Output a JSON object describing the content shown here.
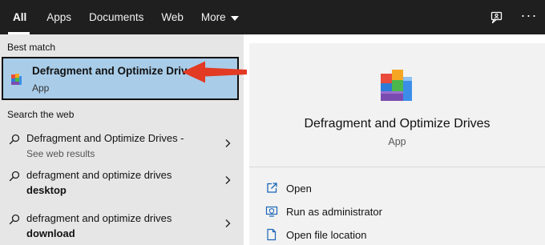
{
  "colors": {
    "topbar_bg": "#1f1f1f",
    "left_panel_bg": "#e6e6e6",
    "selected_bg": "#a9cde9",
    "right_panel_bg": "#f2f2f2",
    "action_icon": "#1a66b8",
    "arrow": "#e23a23"
  },
  "topbar": {
    "tabs": [
      {
        "label": "All",
        "active": true
      },
      {
        "label": "Apps"
      },
      {
        "label": "Documents"
      },
      {
        "label": "Web"
      },
      {
        "label": "More"
      }
    ],
    "actions": {
      "feedback_icon": "feedback-icon",
      "more_options": "···"
    }
  },
  "left": {
    "best_match_label": "Best match",
    "best_match": {
      "title": "Defragment and Optimize Drives",
      "subtitle": "App",
      "icon": "defrag-app-icon"
    },
    "search_web_label": "Search the web",
    "web_results": [
      {
        "line1": "Defragment and Optimize Drives -",
        "line2": "See web results"
      },
      {
        "line1": "defragment and optimize drives",
        "line2": "desktop"
      },
      {
        "line1": "defragment and optimize drives",
        "line2": "download"
      }
    ]
  },
  "right": {
    "app_title": "Defragment and Optimize Drives",
    "app_type": "App",
    "actions": [
      {
        "label": "Open",
        "icon": "open-icon"
      },
      {
        "label": "Run as administrator",
        "icon": "shield-icon"
      },
      {
        "label": "Open file location",
        "icon": "file-location-icon"
      }
    ]
  }
}
